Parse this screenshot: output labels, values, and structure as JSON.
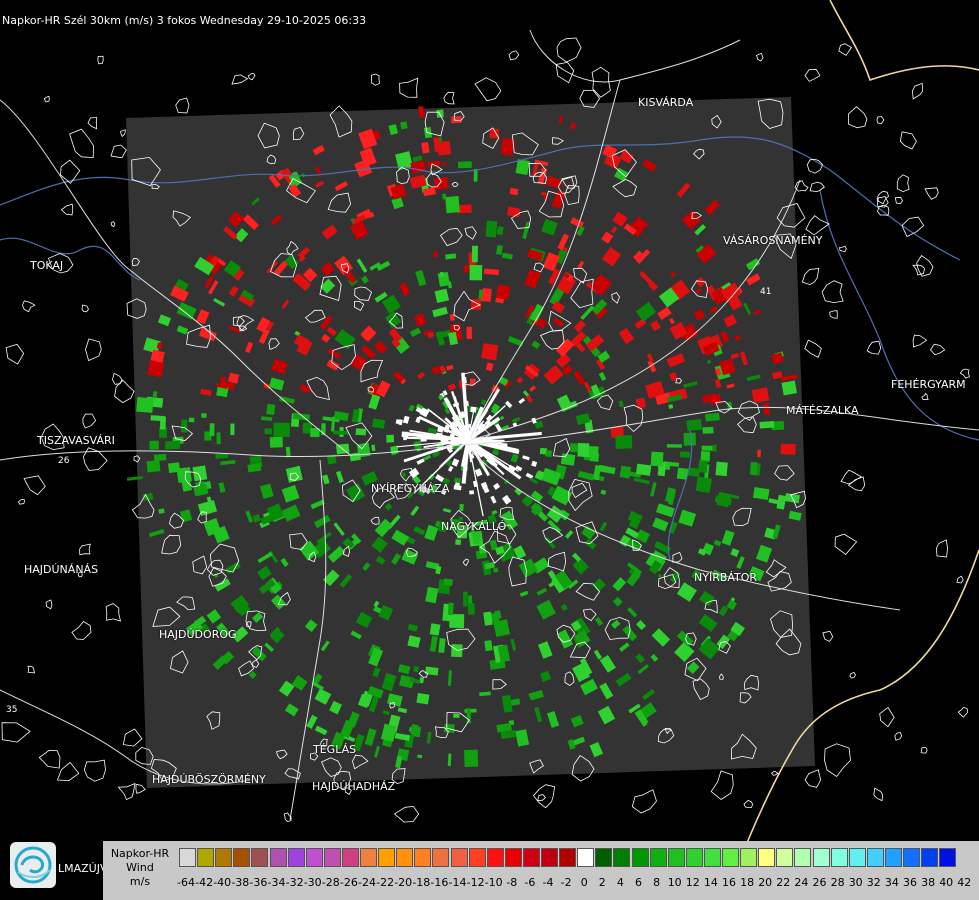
{
  "title": "Napkor-HR Szél 30km (m/s) 3 fokos Wednesday 29-10-2025 06:33",
  "colors": {
    "background": "#000000",
    "radar_area": "#333333",
    "approaching": "#e01010",
    "receding": "#10b010"
  },
  "cities": [
    {
      "name": "KISVÁRDA"
    },
    {
      "name": "TOKAJ"
    },
    {
      "name": "VÁSÁROSNAMÉNY"
    },
    {
      "name": "FEHÉRGYARM"
    },
    {
      "name": "MÁTÉSZALKA"
    },
    {
      "name": "TISZAVASVÁRI"
    },
    {
      "name": "NYÍREGYHÁZA"
    },
    {
      "name": "NAGYKÁLLÓ"
    },
    {
      "name": "HAJDÚNÁNÁS"
    },
    {
      "name": "NYÍRBÁTOR"
    },
    {
      "name": "HAJDÚDOROG"
    },
    {
      "name": "TÉGLÁS"
    },
    {
      "name": "HAJDÚBÖSZÖRMÉNY"
    },
    {
      "name": "HAJDÚHADHÁZ"
    }
  ],
  "roads": [
    "26",
    "41",
    "35"
  ],
  "logo": {
    "text": "LMAZÚJVÁR",
    "icon": "napkor-logo-icon"
  },
  "legend": {
    "title_lines": [
      "Napkor-HR",
      "Wind",
      "m/s"
    ],
    "labels": [
      "-64",
      "-42",
      "-40",
      "-38",
      "-36",
      "-34",
      "-32",
      "-30",
      "-28",
      "-26",
      "-24",
      "-22",
      "-20",
      "-18",
      "-16",
      "-14",
      "-12",
      "-10",
      "-8",
      "-6",
      "-4",
      "-2",
      "0",
      "2",
      "4",
      "6",
      "8",
      "10",
      "12",
      "14",
      "16",
      "18",
      "20",
      "22",
      "24",
      "26",
      "28",
      "30",
      "32",
      "34",
      "36",
      "38",
      "40",
      "42"
    ],
    "colors": [
      "#d8d8d8",
      "#b0a800",
      "#b07a00",
      "#a85000",
      "#a05050",
      "#b050b0",
      "#a040e0",
      "#c050d0",
      "#c050b0",
      "#d04080",
      "#f08040",
      "#ffa000",
      "#ff9010",
      "#ff8020",
      "#f07040",
      "#f06040",
      "#ff4020",
      "#ff1010",
      "#e80000",
      "#d00010",
      "#c00010",
      "#b00000",
      "#ffffff",
      "#006000",
      "#008000",
      "#009800",
      "#10b010",
      "#20c020",
      "#30d030",
      "#40e040",
      "#60f040",
      "#a0f060",
      "#ffff80",
      "#d0ffa0",
      "#b0ffb0",
      "#a0ffd0",
      "#80ffe0",
      "#60f0f0",
      "#40d0ff",
      "#20a0ff",
      "#1070ff",
      "#0040f0",
      "#0010e0"
    ]
  }
}
